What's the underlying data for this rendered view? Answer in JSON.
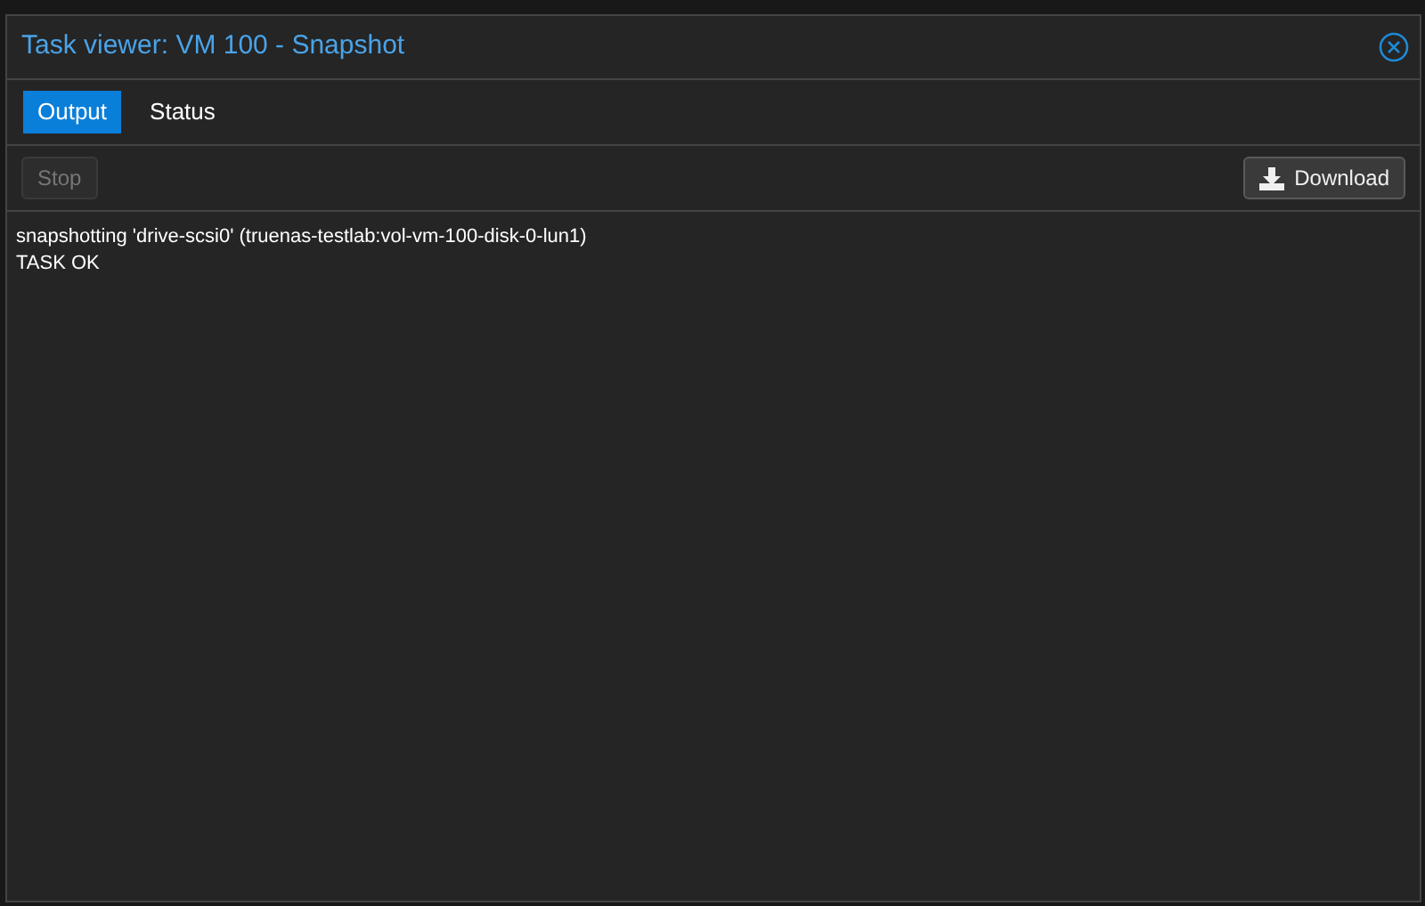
{
  "window": {
    "title": "Task viewer: VM 100 - Snapshot"
  },
  "tabs": [
    {
      "label": "Output",
      "selected": true
    },
    {
      "label": "Status",
      "selected": false
    }
  ],
  "toolbar": {
    "stop": {
      "label": "Stop",
      "disabled": true
    },
    "download": {
      "label": "Download",
      "disabled": false
    }
  },
  "log": [
    "snapshotting 'drive-scsi0' (truenas-testlab:vol-vm-100-disk-0-lun1)",
    "TASK OK"
  ]
}
